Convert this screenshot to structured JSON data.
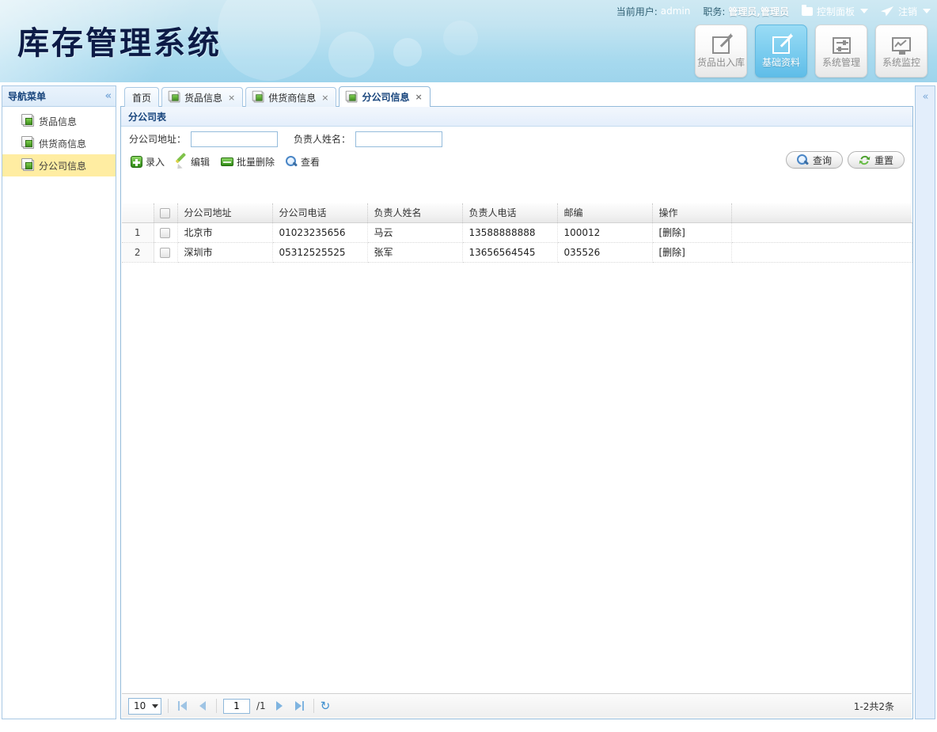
{
  "header": {
    "app_title": "库存管理系统",
    "userbar": {
      "current_user_label": "当前用户:",
      "current_user": "admin",
      "role_label": "职务:",
      "role": "管理员,管理员",
      "control_panel": "控制面板",
      "logout": "注销",
      "panel_icon": "panel-icon",
      "logout_icon": "paper-plane-icon"
    },
    "modules": [
      {
        "label": "货品出入库",
        "icon": "edit-square-icon",
        "active": false
      },
      {
        "label": "基础资料",
        "icon": "edit-square-icon",
        "active": true
      },
      {
        "label": "系统管理",
        "icon": "sliders-icon",
        "active": false
      },
      {
        "label": "系统监控",
        "icon": "monitor-chart-icon",
        "active": false
      }
    ]
  },
  "sidebar": {
    "title": "导航菜单",
    "collapse_icon": "«",
    "items": [
      {
        "label": "货品信息",
        "icon": "document-icon",
        "selected": false
      },
      {
        "label": "供货商信息",
        "icon": "document-icon",
        "selected": false
      },
      {
        "label": "分公司信息",
        "icon": "document-icon",
        "selected": true
      }
    ]
  },
  "right_strip": {
    "collapse_icon": "«"
  },
  "tabs": [
    {
      "label": "首页",
      "closable": false,
      "active": false
    },
    {
      "label": "货品信息",
      "closable": true,
      "active": false
    },
    {
      "label": "供货商信息",
      "closable": true,
      "active": false
    },
    {
      "label": "分公司信息",
      "closable": true,
      "active": true
    }
  ],
  "panel": {
    "title": "分公司表",
    "search": {
      "address_label": "分公司地址：",
      "address_value": "",
      "address_placeholder": "",
      "manager_label": "负责人姓名：",
      "manager_value": "",
      "manager_placeholder": ""
    },
    "toolbar": [
      {
        "label": "录入",
        "icon": "plus-icon"
      },
      {
        "label": "编辑",
        "icon": "pencil-icon"
      },
      {
        "label": "批量删除",
        "icon": "bar-delete-icon"
      },
      {
        "label": "查看",
        "icon": "magnifier-icon"
      }
    ],
    "actions": {
      "query_label": "查询",
      "query_icon": "magnifier-icon",
      "reset_label": "重置",
      "reset_icon": "refresh-icon"
    },
    "table": {
      "columns": [
        "分公司地址",
        "分公司电话",
        "负责人姓名",
        "负责人电话",
        "邮编",
        "操作"
      ],
      "rows": [
        {
          "num": "1",
          "address": "北京市",
          "phone": "01023235656",
          "manager": "马云",
          "manager_phone": "13588888888",
          "zip": "100012",
          "action": "[删除]"
        },
        {
          "num": "2",
          "address": "深圳市",
          "phone": "05312525525",
          "manager": "张军",
          "manager_phone": "13656564545",
          "zip": "035526",
          "action": "[删除]"
        }
      ]
    },
    "pager": {
      "page_size": "10",
      "page_value": "1",
      "total_pages": "/1",
      "info": "1-2共2条",
      "first_icon": "first-page-icon",
      "prev_icon": "prev-page-icon",
      "next_icon": "next-page-icon",
      "last_icon": "last-page-icon",
      "refresh_icon": "refresh-icon"
    }
  },
  "colors": {
    "header_blue": "#a6d9ee",
    "accent": "#17447c",
    "selected_row": "#ffeda2",
    "active_module": "#7ccdef"
  }
}
